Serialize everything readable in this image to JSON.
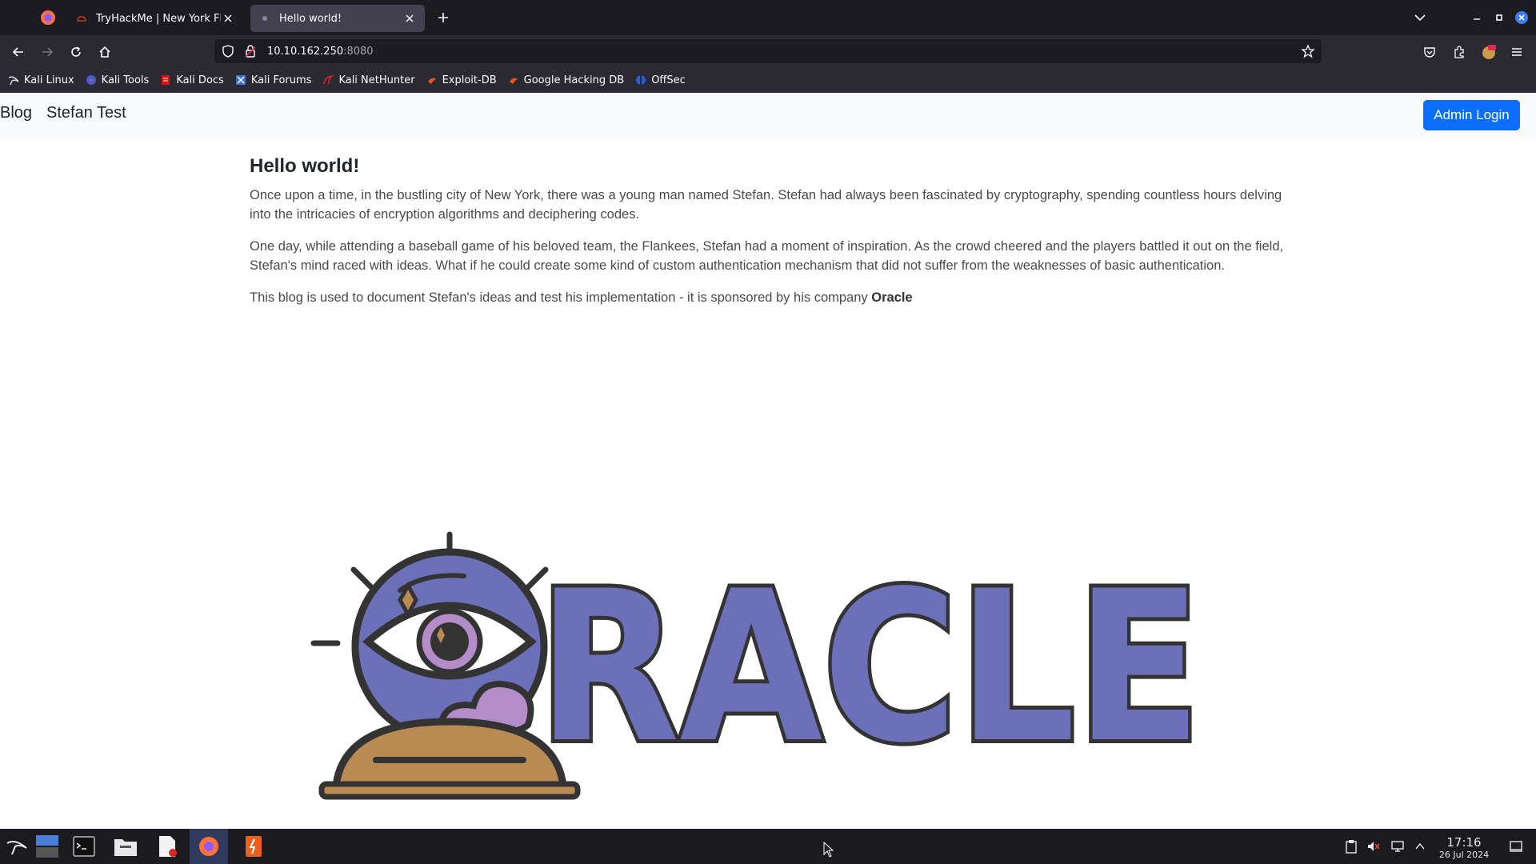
{
  "browser": {
    "tabs": [
      {
        "label": "TryHackMe | New York Fla",
        "active": false
      },
      {
        "label": "Hello world!",
        "active": true
      }
    ],
    "url": {
      "host": "10.10.162.250",
      "port": ":8080"
    },
    "bookmarks": [
      {
        "label": "Kali Linux",
        "icon": "kali-icon"
      },
      {
        "label": "Kali Tools",
        "icon": "kali-tools-icon"
      },
      {
        "label": "Kali Docs",
        "icon": "kali-docs-icon"
      },
      {
        "label": "Kali Forums",
        "icon": "kali-forums-icon"
      },
      {
        "label": "Kali NetHunter",
        "icon": "nethunter-icon"
      },
      {
        "label": "Exploit-DB",
        "icon": "exploit-db-icon"
      },
      {
        "label": "Google Hacking DB",
        "icon": "ghdb-icon"
      },
      {
        "label": "OffSec",
        "icon": "offsec-icon"
      }
    ]
  },
  "site": {
    "brand": "Blog",
    "nav_link": "Stefan Test",
    "admin_button": "Admin Login"
  },
  "article": {
    "title": "Hello world!",
    "paragraph1": "Once upon a time, in the bustling city of New York, there was a young man named Stefan. Stefan had always been fascinated by cryptography, spending countless hours delving into the intricacies of encryption algorithms and deciphering codes.",
    "paragraph2": "One day, while attending a baseball game of his beloved team, the Flankees, Stefan had a moment of inspiration. As the crowd cheered and the players battled it out on the field, Stefan's mind raced with ideas. What if he could create some kind of custom authentication mechanism that did not suffer from the weaknesses of basic authentication.",
    "paragraph3_prefix": "This blog is used to document Stefan's ideas and test his implementation - it is sponsored by his company ",
    "paragraph3_company": "Oracle"
  },
  "logo": {
    "text": "RACLE",
    "fill": "#6b70b8",
    "outline": "#333333",
    "accent": "#b48cc8",
    "base": "#b98a52"
  },
  "taskbar": {
    "time": "17:16",
    "date": "26 Jul 2024"
  },
  "colors": {
    "accent": "#0d6efd",
    "chrome_dark": "#1c1b22",
    "chrome": "#2b2a33"
  }
}
